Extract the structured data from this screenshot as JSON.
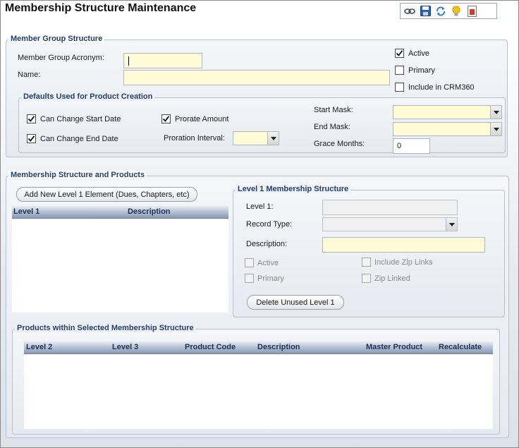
{
  "title": "Membership Structure Maintenance",
  "toolbar": {
    "icons": [
      "link-icon",
      "save-icon",
      "refresh-icon",
      "lightbulb-icon",
      "report-icon"
    ]
  },
  "member_group": {
    "legend": "Member Group Structure",
    "acronym_label": "Member Group Acronym:",
    "acronym_value": "",
    "name_label": "Name:",
    "name_value": "",
    "active_label": "Active",
    "active_checked": true,
    "primary_label": "Primary",
    "primary_checked": false,
    "crm_label": "Include in CRM360",
    "crm_checked": false
  },
  "defaults": {
    "legend": "Defaults Used for Product Creation",
    "start_date_label": "Can Change Start Date",
    "start_date_checked": true,
    "end_date_label": "Can Change End Date",
    "end_date_checked": true,
    "prorate_label": "Prorate Amount",
    "prorate_checked": true,
    "proration_interval_label": "Proration Interval:",
    "proration_interval_value": "",
    "start_mask_label": "Start Mask:",
    "start_mask_value": "",
    "end_mask_label": "End Mask:",
    "end_mask_value": "",
    "grace_months_label": "Grace Months:",
    "grace_months_value": "0"
  },
  "structure": {
    "legend": "Membership Structure and Products",
    "add_button": "Add New Level 1 Element (Dues, Chapters, etc)",
    "level1_grid": {
      "columns": [
        "Level 1",
        "Description"
      ],
      "rows": []
    }
  },
  "level1_detail": {
    "legend": "Level 1 Membership Structure",
    "level1_label": "Level 1:",
    "level1_value": "",
    "record_type_label": "Record Type:",
    "record_type_value": "",
    "description_label": "Description:",
    "description_value": "",
    "active_label": "Active",
    "primary_label": "Primary",
    "include_zip_label": "Include Zip Links",
    "zip_linked_label": "Zip Linked",
    "delete_button": "Delete Unused Level 1"
  },
  "products": {
    "legend": "Products within Selected Membership Structure",
    "columns": [
      "Level 2",
      "Level 3",
      "Product Code",
      "Description",
      "Master Product",
      "Recalculate"
    ],
    "rows": []
  }
}
